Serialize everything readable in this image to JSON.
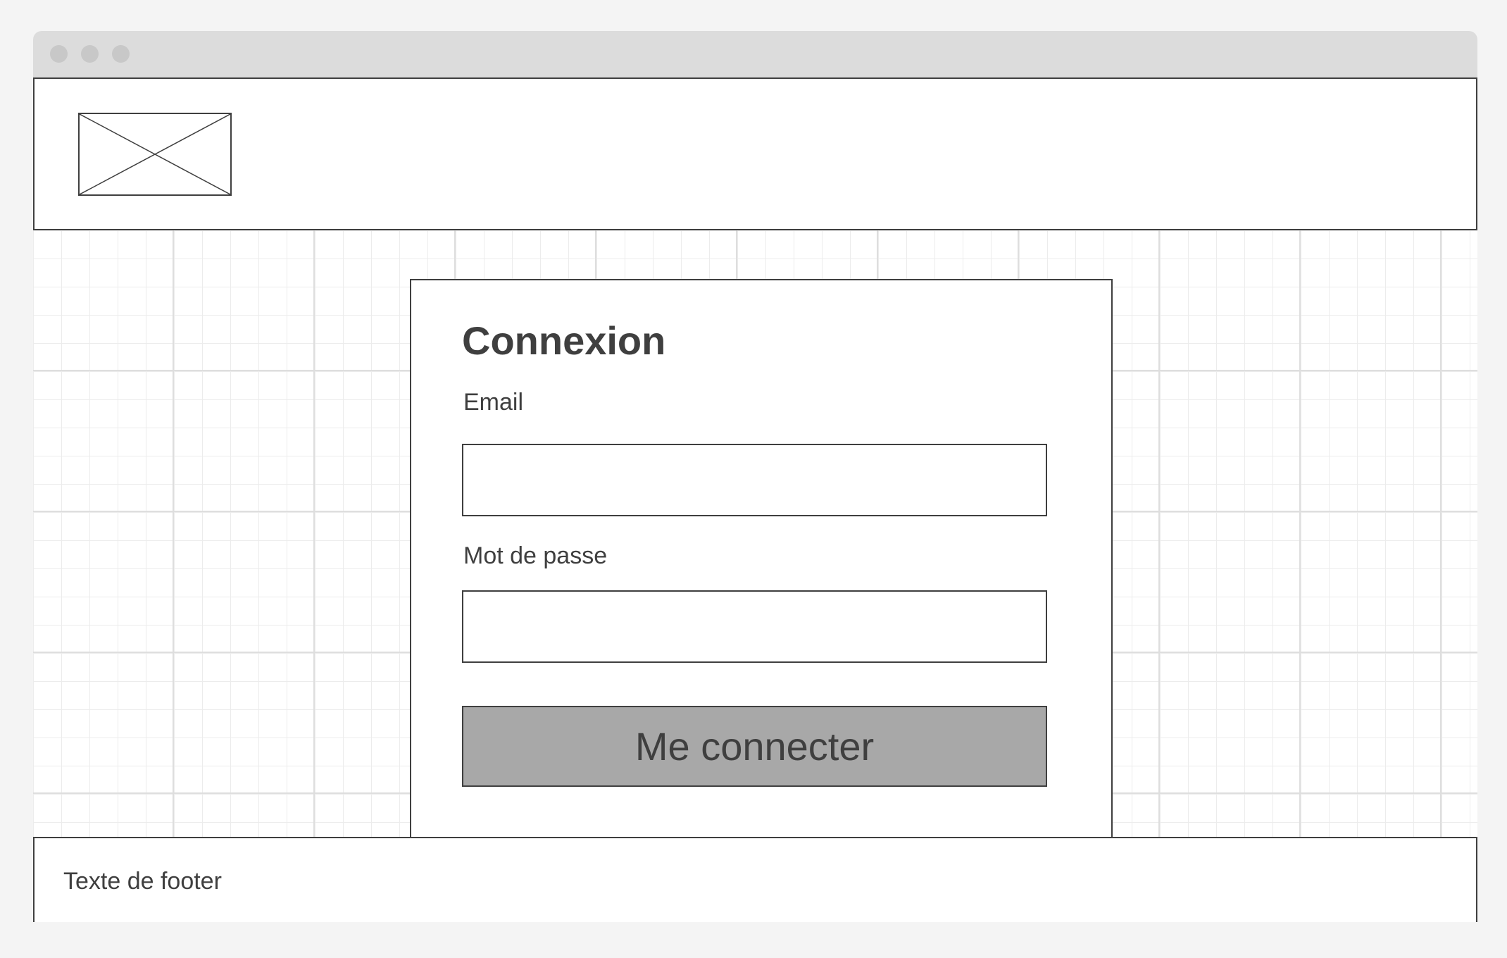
{
  "window": {
    "controls": [
      "close-dot",
      "minimize-dot",
      "maximize-dot"
    ]
  },
  "header": {
    "logo_icon": "image-placeholder-icon"
  },
  "login": {
    "title": "Connexion",
    "email_label": "Email",
    "email_value": "",
    "password_label": "Mot de passe",
    "password_value": "",
    "submit_label": "Me connecter",
    "submit_color": "#a8a8a8"
  },
  "footer": {
    "text": "Texte de footer"
  }
}
